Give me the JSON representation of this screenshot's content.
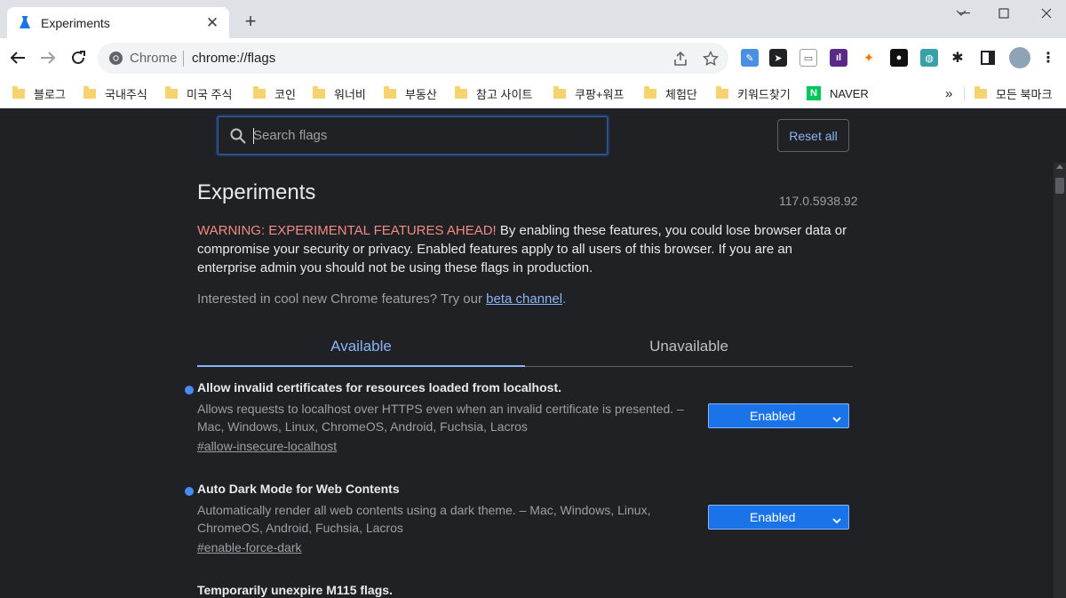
{
  "tab": {
    "title": "Experiments"
  },
  "omnibox": {
    "scheme_label": "Chrome",
    "url": "chrome://flags"
  },
  "bookmarks": {
    "items": [
      "블로그",
      "국내주식",
      "미국 주식",
      "코인",
      "워너비",
      "부동산",
      "참고 사이트",
      "쿠팡+워프",
      "체험단",
      "키워드찾기",
      "NAVER"
    ],
    "overflow": "»",
    "all_bookmarks": "모든 북마크"
  },
  "page": {
    "search_placeholder": "Search flags",
    "reset_label": "Reset all",
    "title": "Experiments",
    "version": "117.0.5938.92",
    "warning_label": "WARNING: EXPERIMENTAL FEATURES AHEAD!",
    "warning_text": " By enabling these features, you could lose browser data or compromise your security or privacy. Enabled features apply to all users of this browser. If you are an enterprise admin you should not be using these flags in production.",
    "interest_text": "Interested in cool new Chrome features? Try our ",
    "beta_link": "beta channel",
    "interest_end": ".",
    "tabs": [
      "Available",
      "Unavailable"
    ]
  },
  "flags": [
    {
      "name": "Allow invalid certificates for resources loaded from localhost.",
      "description": "Allows requests to localhost over HTTPS even when an invalid certificate is presented. – Mac, Windows, Linux, ChromeOS, Android, Fuchsia, Lacros",
      "link": "#allow-insecure-localhost",
      "value": "Enabled"
    },
    {
      "name": "Auto Dark Mode for Web Contents",
      "description": "Automatically render all web contents using a dark theme. – Mac, Windows, Linux, ChromeOS, Android, Fuchsia, Lacros",
      "link": "#enable-force-dark",
      "value": "Enabled"
    },
    {
      "name": "Temporarily unexpire M115 flags."
    }
  ],
  "colors": {
    "accent": "#8ab4f8",
    "warning": "#f28b82",
    "select_bg": "#1a73e8",
    "page_bg": "#202124"
  }
}
